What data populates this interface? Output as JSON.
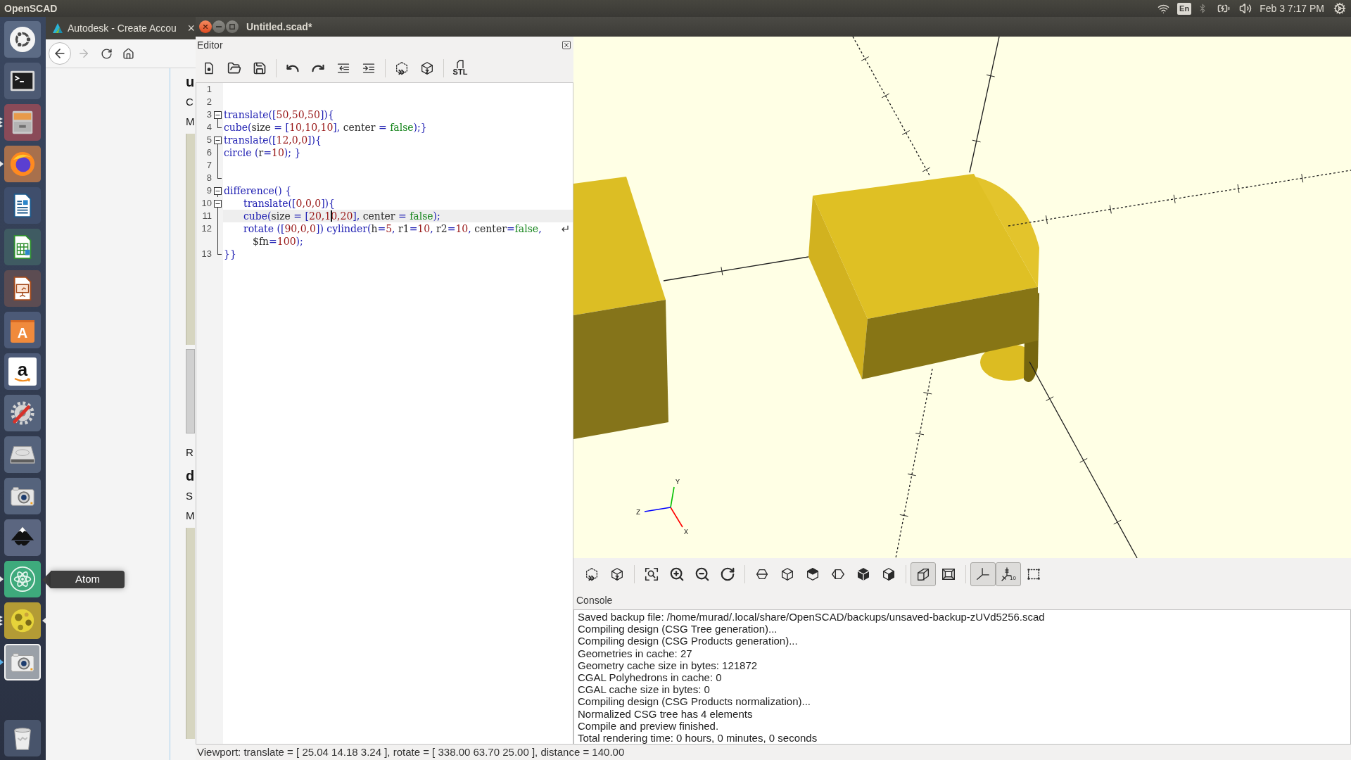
{
  "top_panel": {
    "app_name": "OpenSCAD",
    "keyboard_layout": "En",
    "clock": "Feb 3 7:17 PM"
  },
  "launcher": [
    {
      "running": false,
      "focused": false,
      "highlighted": false
    },
    {
      "running": false,
      "focused": false,
      "highlighted": false
    },
    {
      "running": true,
      "multiple": true,
      "focused": false,
      "highlighted": false
    },
    {
      "running": true,
      "multiple": false,
      "focused": false,
      "highlighted": false
    },
    {
      "running": false,
      "focused": false,
      "highlighted": false
    },
    {
      "running": false,
      "focused": false,
      "highlighted": false
    },
    {
      "running": false,
      "focused": false,
      "highlighted": false
    },
    {
      "running": false,
      "focused": false,
      "highlighted": false,
      "glyph": "A"
    },
    {
      "running": false,
      "focused": false,
      "highlighted": false,
      "glyph": "a"
    },
    {
      "running": false,
      "focused": false,
      "highlighted": false
    },
    {
      "running": false,
      "focused": false,
      "highlighted": false
    },
    {
      "running": false,
      "focused": false,
      "highlighted": false
    },
    {
      "running": false,
      "focused": false,
      "highlighted": false
    },
    {
      "running": true,
      "multiple": false,
      "focused": false,
      "highlighted": false
    },
    {
      "running": true,
      "multiple": true,
      "focused": true,
      "highlighted": false
    },
    {
      "running": true,
      "multiple": false,
      "focused": false,
      "highlighted": true
    },
    {
      "running": false,
      "focused": false,
      "highlighted": false
    }
  ],
  "launcher_tooltip": "Atom",
  "browser": {
    "tab_title": "Autodesk - Create Accou",
    "tab_close": "×",
    "forward_disabled": true,
    "page": [
      {
        "kind": "heading",
        "text": "u"
      },
      {
        "kind": "text",
        "text": "C"
      },
      {
        "kind": "text",
        "text": "M"
      },
      {
        "kind": "image"
      },
      {
        "kind": "panel"
      },
      {
        "kind": "text",
        "text": "R"
      },
      {
        "kind": "heading",
        "text": "d"
      },
      {
        "kind": "text",
        "text": "S"
      },
      {
        "kind": "text",
        "text": "M"
      },
      {
        "kind": "image"
      }
    ]
  },
  "window": {
    "title": "Untitled.scad*"
  },
  "editor": {
    "title": "Editor",
    "export_label": "STL",
    "lines": [
      {
        "number": "1",
        "kind": "plain",
        "current": false
      },
      {
        "number": "2",
        "kind": "plain",
        "current": false
      },
      {
        "number": "3",
        "kind": "start",
        "current": false,
        "tokens": [
          {
            "kind": "ident",
            "text": "translate(["
          },
          {
            "kind": "number",
            "text": "50,50,50"
          },
          {
            "kind": "ident",
            "text": "]){"
          }
        ]
      },
      {
        "number": "4",
        "kind": "end",
        "current": false,
        "tokens": [
          {
            "kind": "ident",
            "text": "cube("
          },
          {
            "kind": "plain",
            "text": "size "
          },
          {
            "kind": "ident",
            "text": "= ["
          },
          {
            "kind": "number",
            "text": "10,10,10"
          },
          {
            "kind": "ident",
            "text": "], "
          },
          {
            "kind": "plain",
            "text": "center "
          },
          {
            "kind": "ident",
            "text": "= "
          },
          {
            "kind": "bool",
            "text": "false"
          },
          {
            "kind": "ident",
            "text": ");}"
          }
        ]
      },
      {
        "number": "5",
        "kind": "start",
        "current": false,
        "tokens": [
          {
            "kind": "ident",
            "text": "translate(["
          },
          {
            "kind": "number",
            "text": "12,0,0"
          },
          {
            "kind": "ident",
            "text": "]){"
          }
        ]
      },
      {
        "number": "6",
        "kind": "body",
        "current": false,
        "tokens": [
          {
            "kind": "ident",
            "text": "circle ("
          },
          {
            "kind": "plain",
            "text": "r"
          },
          {
            "kind": "ident",
            "text": "="
          },
          {
            "kind": "number",
            "text": "10"
          },
          {
            "kind": "ident",
            "text": "); }"
          }
        ]
      },
      {
        "number": "7",
        "kind": "body",
        "current": false
      },
      {
        "number": "8",
        "kind": "end",
        "current": false
      },
      {
        "number": "9",
        "kind": "start",
        "current": false,
        "tokens": [
          {
            "kind": "ident",
            "text": "difference() {"
          }
        ]
      },
      {
        "number": "10",
        "kind": "start",
        "current": false,
        "tokens": [
          {
            "kind": "ident",
            "text": "\ttranslate(["
          },
          {
            "kind": "number",
            "text": "0,0,0"
          },
          {
            "kind": "ident",
            "text": "]){"
          }
        ]
      },
      {
        "number": "11",
        "kind": "body",
        "current": true,
        "tokens": [
          {
            "kind": "ident",
            "text": "\tcube("
          },
          {
            "kind": "plain",
            "text": "size "
          },
          {
            "kind": "ident",
            "text": "= ["
          },
          {
            "kind": "number",
            "text": "20,1"
          },
          {
            "kind": "cursor"
          },
          {
            "kind": "number",
            "text": "0,20"
          },
          {
            "kind": "ident",
            "text": "], "
          },
          {
            "kind": "plain",
            "text": "center "
          },
          {
            "kind": "ident",
            "text": "= "
          },
          {
            "kind": "bool",
            "text": "false"
          },
          {
            "kind": "ident",
            "text": ");"
          }
        ]
      },
      {
        "number": "12",
        "kind": "body",
        "current": false,
        "tokens": [
          {
            "kind": "ident",
            "text": "\trotate (["
          },
          {
            "kind": "number",
            "text": "90,0,0"
          },
          {
            "kind": "ident",
            "text": "]) cylinder("
          },
          {
            "kind": "plain",
            "text": "h"
          },
          {
            "kind": "ident",
            "text": "="
          },
          {
            "kind": "number",
            "text": "5"
          },
          {
            "kind": "ident",
            "text": ", "
          },
          {
            "kind": "plain",
            "text": "r1"
          },
          {
            "kind": "ident",
            "text": "="
          },
          {
            "kind": "number",
            "text": "10"
          },
          {
            "kind": "ident",
            "text": ", "
          },
          {
            "kind": "plain",
            "text": "r2"
          },
          {
            "kind": "ident",
            "text": "="
          },
          {
            "kind": "number",
            "text": "10"
          },
          {
            "kind": "ident",
            "text": ", "
          },
          {
            "kind": "plain",
            "text": "center"
          },
          {
            "kind": "ident",
            "text": "="
          },
          {
            "kind": "bool",
            "text": "false"
          },
          {
            "kind": "ident",
            "text": ","
          }
        ],
        "continuation": {
          "kind": "body",
          "tokens": [
            {
              "kind": "plain",
              "text": "$fn"
            },
            {
              "kind": "ident",
              "text": "="
            },
            {
              "kind": "number",
              "text": "100"
            },
            {
              "kind": "ident",
              "text": ");"
            }
          ]
        }
      },
      {
        "number": "13",
        "kind": "end",
        "current": false,
        "tokens": [
          {
            "kind": "ident",
            "text": "}}"
          }
        ]
      }
    ]
  },
  "viewport": {
    "axis_labels": [
      "X",
      "Y",
      "Z"
    ],
    "toolbar": [
      [
        {
          "pressed": false
        },
        {
          "pressed": false
        }
      ],
      [
        {
          "pressed": false
        },
        {
          "pressed": false
        },
        {
          "pressed": false
        },
        {
          "pressed": false
        }
      ],
      [
        {
          "pressed": false
        },
        {
          "pressed": false
        },
        {
          "pressed": false
        },
        {
          "pressed": false
        },
        {
          "pressed": false
        },
        {
          "pressed": false
        }
      ],
      [
        {
          "pressed": true
        },
        {
          "pressed": false
        }
      ],
      [
        {
          "pressed": true
        },
        {
          "pressed": true,
          "label": "10"
        },
        {
          "pressed": false
        }
      ]
    ]
  },
  "console": {
    "title": "Console",
    "lines": [
      "Saved backup file: /home/murad/.local/share/OpenSCAD/backups/unsaved-backup-zUVd5256.scad",
      "Compiling design (CSG Tree generation)...",
      "Compiling design (CSG Products generation)...",
      "Geometries in cache: 27",
      "Geometry cache size in bytes: 121872",
      "CGAL Polyhedrons in cache: 0",
      "CGAL cache size in bytes: 0",
      "Compiling design (CSG Products normalization)...",
      "Normalized CSG tree has 4 elements",
      "Compile and preview finished.",
      "Total rendering time: 0 hours, 0 minutes, 0 seconds"
    ]
  },
  "status_bar": "Viewport: translate = [ 25.04 14.18 3.24 ], rotate = [ 338.00 63.70 25.00 ], distance = 140.00"
}
